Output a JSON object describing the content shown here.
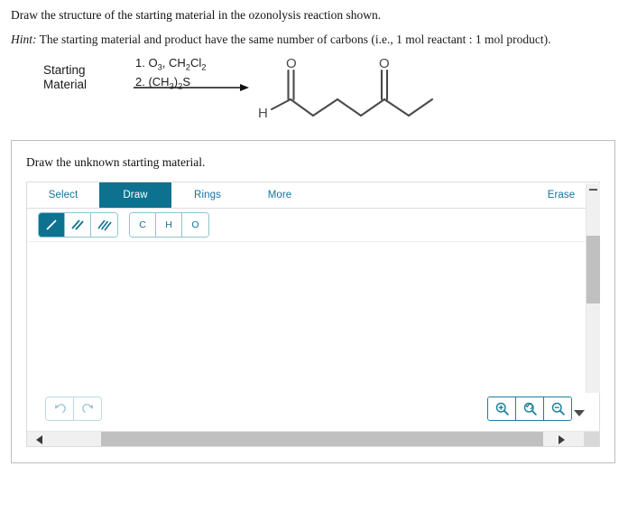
{
  "question": {
    "prompt": "Draw the structure of the starting material in the ozonolysis reaction shown.",
    "hint_label": "Hint:",
    "hint_text": " The starting material and product have the same number of carbons (i.e., 1 mol reactant : 1 mol product)."
  },
  "reaction": {
    "reactant_line1": "Starting",
    "reactant_line2": "Material",
    "condition_above": "1. O3, CH2Cl2",
    "condition_below": "2. (CH3)2S",
    "product_label_h": "H",
    "product_oxygen_1": "O",
    "product_oxygen_2": "O"
  },
  "answer_card": {
    "title": "Draw the unknown starting material."
  },
  "editor": {
    "tabs": [
      {
        "label": "Select",
        "active": false
      },
      {
        "label": "Draw",
        "active": true
      },
      {
        "label": "Rings",
        "active": false
      },
      {
        "label": "More",
        "active": false
      }
    ],
    "erase_tab": "Erase",
    "bond_tools": [
      {
        "name": "single-bond",
        "selected": true
      },
      {
        "name": "double-bond",
        "selected": false
      },
      {
        "name": "triple-bond",
        "selected": false
      }
    ],
    "atom_tools": [
      {
        "label": "C"
      },
      {
        "label": "H"
      },
      {
        "label": "O"
      }
    ],
    "history_buttons": [
      {
        "name": "undo"
      },
      {
        "name": "redo"
      }
    ],
    "zoom_buttons": [
      {
        "name": "zoom-in"
      },
      {
        "name": "zoom-reset"
      },
      {
        "name": "zoom-out"
      }
    ]
  },
  "colors": {
    "accent_teal": "#0d7290",
    "link_teal": "#1274a0",
    "border_gray": "#bdbdbd",
    "scrollbar_thumb": "#c0c0c0"
  }
}
